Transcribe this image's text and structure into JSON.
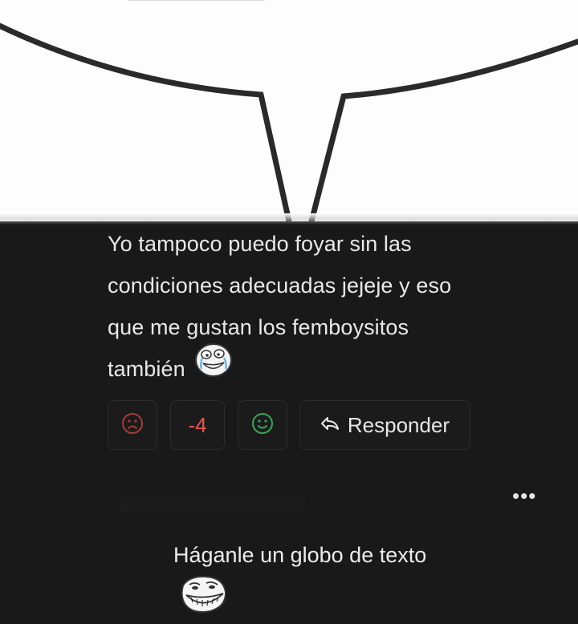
{
  "comment": {
    "lines": [
      "Yo tampoco puedo foyar sin las",
      "condiciones adecuadas jejeje y eso",
      "que me gustan los femboysitos",
      "también"
    ],
    "emoji_icon": "crying-laughing-rage-face-icon"
  },
  "actions": {
    "dislike_icon": "sad-face-icon",
    "score": "-4",
    "like_icon": "happy-face-icon",
    "reply_icon": "reply-arrow-icon",
    "reply_label": "Responder"
  },
  "menu": {
    "more_label": "•••"
  },
  "reply": {
    "text": "Háganle un globo de texto",
    "emoji_icon": "troll-face-icon"
  },
  "colors": {
    "background": "#191919",
    "text": "#e9e9e9",
    "negative": "#e8564b",
    "positive": "#3aa657",
    "button_border": "#2c2c2c"
  }
}
